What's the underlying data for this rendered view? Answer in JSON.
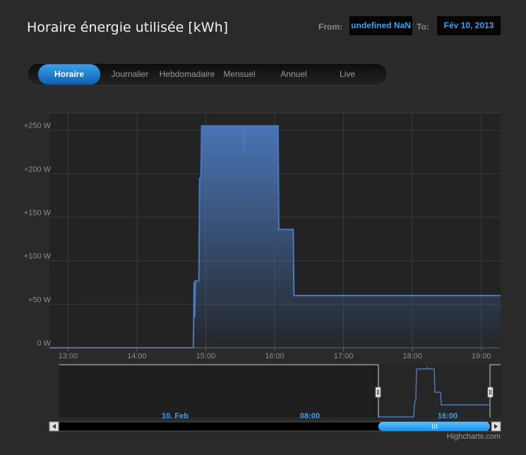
{
  "header": {
    "title": "Horaire énergie utilisée [kWh]",
    "from_label": "From:",
    "from_value": "undefined NaN",
    "to_label": "To:",
    "to_value": "Fév 10, 2013"
  },
  "tabs": [
    {
      "label": "Horaire",
      "active": true
    },
    {
      "label": "Journalier",
      "active": false
    },
    {
      "label": "Hebdomadaire",
      "active": false
    },
    {
      "label": "Mensuel",
      "active": false
    },
    {
      "label": "Annuel",
      "active": false
    },
    {
      "label": "Live",
      "active": false
    }
  ],
  "credits": "Highcharts.com",
  "colors": {
    "series": "#4a78bc",
    "accent": "#3ea0f0",
    "background": "#2a2a2a"
  },
  "chart_data": {
    "type": "area",
    "title": "Horaire énergie utilisée [kWh]",
    "y_unit": "W",
    "ylim": [
      0,
      270
    ],
    "y_ticks": [
      0,
      50,
      100,
      150,
      200,
      250
    ],
    "y_tick_labels": [
      "0 W",
      "+50 W",
      "+100 W",
      "+150 W",
      "+200 W",
      "+250 W"
    ],
    "x_ticks": [
      13,
      14,
      15,
      16,
      17,
      18,
      19
    ],
    "x_tick_labels": [
      "13:00",
      "14:00",
      "15:00",
      "16:00",
      "17:00",
      "18:00",
      "19:00"
    ],
    "xlim": [
      12.73,
      19.28
    ],
    "grid": true,
    "series": [
      {
        "x": [
          12.73,
          14.82,
          14.83,
          14.84,
          14.85,
          14.86,
          14.9,
          14.91,
          14.93,
          14.94,
          15.55,
          15.56,
          15.57,
          16.05,
          16.06,
          16.27,
          16.28,
          19.28
        ],
        "values": [
          0,
          0,
          76,
          35,
          78,
          76,
          77,
          195,
          196,
          255,
          255,
          226,
          255,
          255,
          136,
          136,
          60,
          60
        ]
      }
    ],
    "navigator": {
      "tick_labels": [
        "10. Feb",
        "08:00",
        "16:00"
      ],
      "selection": [
        "12:44",
        "19:17"
      ]
    }
  }
}
